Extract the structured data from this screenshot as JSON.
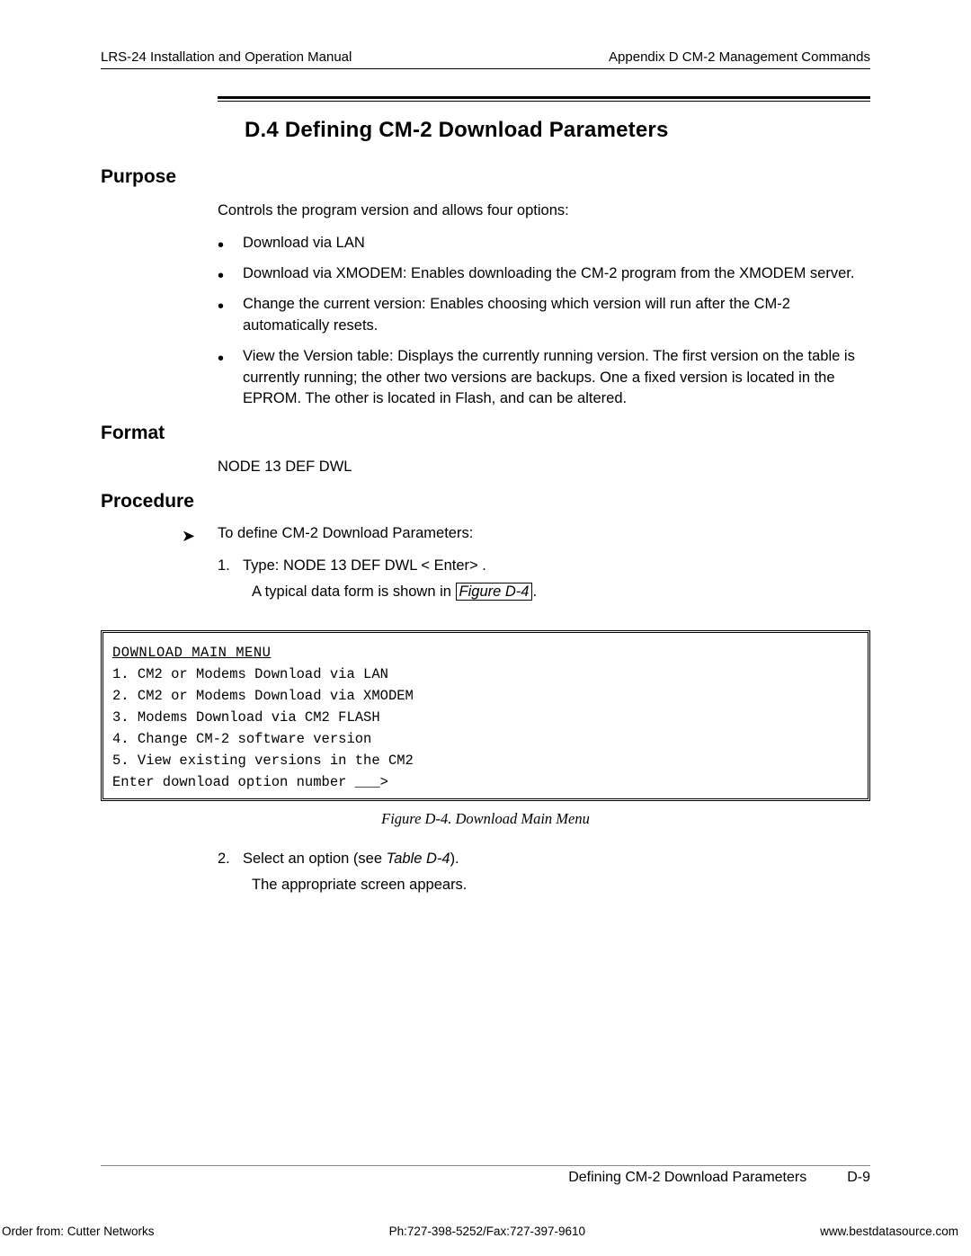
{
  "header": {
    "left": "LRS-24 Installation and Operation Manual",
    "right": "Appendix D  CM-2 Management Commands"
  },
  "title": "D.4  Defining CM-2 Download Parameters",
  "purpose": {
    "heading": "Purpose",
    "intro": "Controls the program version and allows four options:",
    "bullets": [
      "Download via LAN",
      "Download via XMODEM: Enables downloading the CM-2 program from the XMODEM server.",
      "Change the current version: Enables choosing which version will run after the CM-2 automatically resets.",
      "View the Version table: Displays the currently running version. The first version on the table is currently running; the other two versions are backups. One   a fixed version   is located in the EPROM. The other is located in Flash, and can be altered."
    ]
  },
  "format": {
    "heading": "Format",
    "value": "NODE 13 DEF DWL"
  },
  "procedure": {
    "heading": "Procedure",
    "intro": "To define CM-2 Download Parameters:",
    "step1_prefix": "Type:  ",
    "step1_cmd": "NODE 13 DEF DWL < Enter> .",
    "step1_sub_pre": "A typical data form is shown in",
    "step1_figref": "Figure D-4",
    "step1_sub_post": ".",
    "step2_pre": "Select an option (see",
    "step2_tableref": "Table D-4",
    "step2_post": ").",
    "step2_sub": "The appropriate screen appears."
  },
  "menu": {
    "title": "DOWNLOAD MAIN MENU",
    "lines": [
      "1. CM2 or Modems Download via LAN",
      "2. CM2 or Modems Download via XMODEM",
      "3. Modems Download via CM2 FLASH",
      "4. Change CM-2 software version",
      "5. View existing versions in the CM2",
      "Enter download option number ___>"
    ]
  },
  "figure_caption": "Figure D-4.  Download Main Menu",
  "footer": {
    "section": "Defining CM-2 Download Parameters",
    "page": "D-9"
  },
  "bottom": {
    "left": "Order from: Cutter Networks",
    "center": "Ph:727-398-5252/Fax:727-397-9610",
    "right": "www.bestdatasource.com"
  }
}
